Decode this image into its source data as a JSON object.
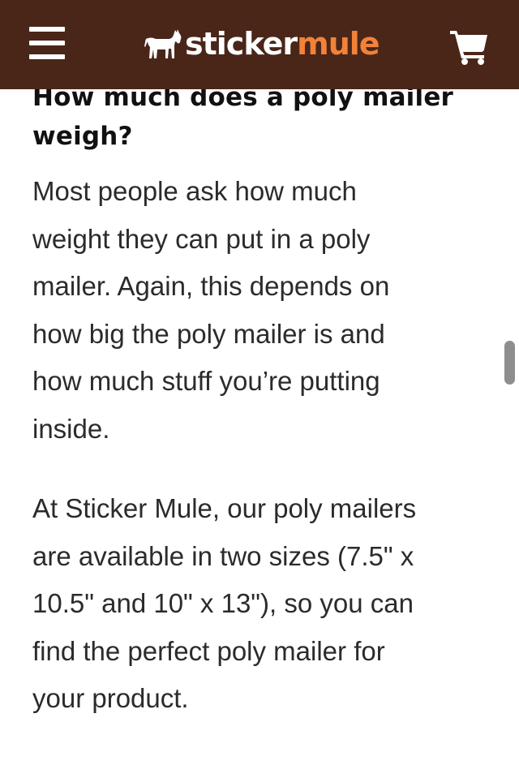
{
  "header": {
    "logo": {
      "word_primary": "sticker",
      "word_accent": "mule"
    },
    "icons": {
      "menu": "hamburger-menu-icon",
      "logo": "mule-icon",
      "cart": "shopping-cart-icon"
    },
    "colors": {
      "background": "#4a2618",
      "accent": "#f0823a",
      "foreground": "#ffffff"
    }
  },
  "article": {
    "heading_line1": "How much does a poly mailer",
    "heading_line2": "weigh?",
    "paragraph1": [
      "Most people ask how much",
      "weight they can put in a poly",
      "mailer. Again, this depends on",
      "how big the poly mailer is and",
      "how much stuff you’re putting",
      "inside."
    ],
    "paragraph2": [
      "At Sticker Mule, our poly mailers",
      "are available in two sizes (7.5\" x",
      "10.5\" and 10\" x 13\"), so you can",
      "find the perfect poly mailer for",
      "your product."
    ]
  }
}
